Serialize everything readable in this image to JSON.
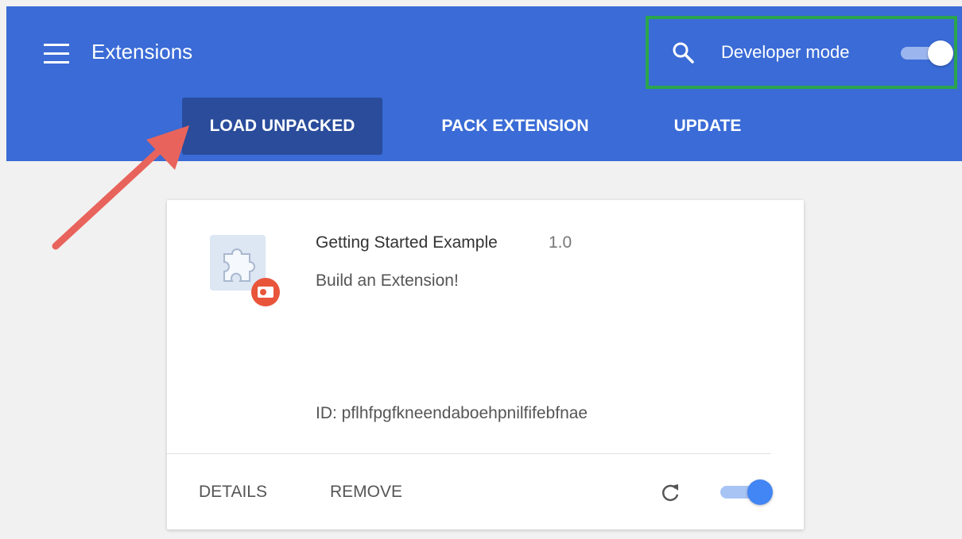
{
  "header": {
    "title": "Extensions",
    "background_color": "#3a6bd6",
    "menu_icon": "hamburger-menu-icon",
    "search_icon": "search-icon",
    "developer_mode": {
      "label": "Developer mode",
      "enabled": true
    },
    "highlight_color": "#2aa54d"
  },
  "toolbar": {
    "load_unpacked_label": "LOAD UNPACKED",
    "pack_extension_label": "PACK EXTENSION",
    "update_label": "UPDATE"
  },
  "annotation": {
    "arrow_color": "#e8635b"
  },
  "extension_card": {
    "name": "Getting Started Example",
    "version": "1.0",
    "description": "Build an Extension!",
    "id_text": "ID: pflhfpgfkneendaboehpnilfifebfnae",
    "details_label": "DETAILS",
    "remove_label": "REMOVE",
    "reload_icon": "reload-icon",
    "enabled": true,
    "icon": "puzzle-piece-icon",
    "badge_icon": "unpacked-badge-icon",
    "badge_color": "#e8553b"
  }
}
